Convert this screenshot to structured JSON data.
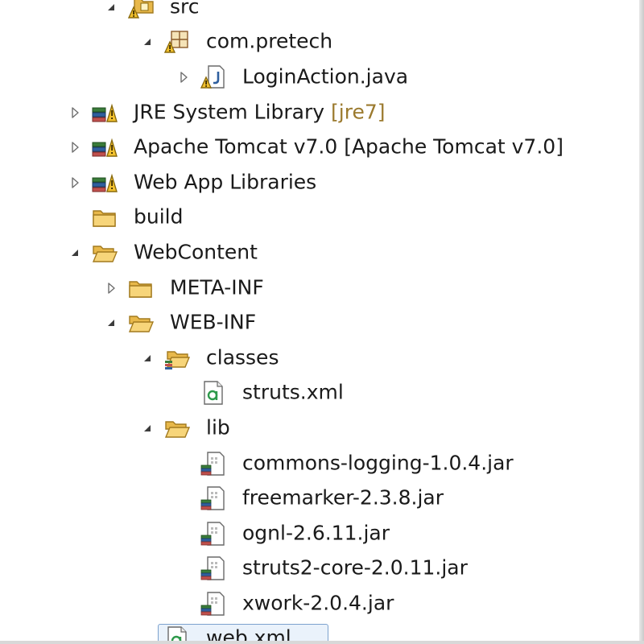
{
  "tree": [
    {
      "label": "src",
      "icon": "source-folder-warning-icon",
      "depth": 0,
      "toggle": "expanded"
    },
    {
      "label": "com.pretech",
      "icon": "package-warning-icon",
      "depth": 1,
      "toggle": "expanded"
    },
    {
      "label": "LoginAction.java",
      "icon": "java-file-warning-icon",
      "depth": 2,
      "toggle": "collapsed"
    },
    {
      "label": "JRE System Library",
      "decoration": "[jre7]",
      "icon": "library-icon",
      "depth": -1,
      "toggle": "collapsed"
    },
    {
      "label": "Apache Tomcat v7.0 [Apache Tomcat v7.0]",
      "icon": "library-icon",
      "depth": -1,
      "toggle": "collapsed"
    },
    {
      "label": "Web App Libraries",
      "icon": "library-icon",
      "depth": -1,
      "toggle": "collapsed"
    },
    {
      "label": "build",
      "icon": "folder-icon",
      "depth": -1,
      "toggle": "none"
    },
    {
      "label": "WebContent",
      "icon": "folder-open-icon",
      "depth": -1,
      "toggle": "expanded"
    },
    {
      "label": "META-INF",
      "icon": "folder-icon",
      "depth": 0,
      "toggle": "collapsed"
    },
    {
      "label": "WEB-INF",
      "icon": "folder-open-icon",
      "depth": 0,
      "toggle": "expanded"
    },
    {
      "label": "classes",
      "icon": "folder-open-stack-icon",
      "depth": 1,
      "toggle": "expanded"
    },
    {
      "label": "struts.xml",
      "icon": "xml-file-icon",
      "depth": 2,
      "toggle": "none"
    },
    {
      "label": "lib",
      "icon": "folder-open-icon",
      "depth": 1,
      "toggle": "expanded"
    },
    {
      "label": "commons-logging-1.0.4.jar",
      "icon": "jar-file-icon",
      "depth": 2,
      "toggle": "none"
    },
    {
      "label": "freemarker-2.3.8.jar",
      "icon": "jar-file-icon",
      "depth": 2,
      "toggle": "none"
    },
    {
      "label": "ognl-2.6.11.jar",
      "icon": "jar-file-icon",
      "depth": 2,
      "toggle": "none"
    },
    {
      "label": "struts2-core-2.0.11.jar",
      "icon": "jar-file-icon",
      "depth": 2,
      "toggle": "none"
    },
    {
      "label": "xwork-2.0.4.jar",
      "icon": "jar-file-icon",
      "depth": 2,
      "toggle": "none"
    },
    {
      "label": "web.xml",
      "icon": "xml-file-icon",
      "depth": 1,
      "toggle": "none",
      "selected": true
    }
  ],
  "colors": {
    "text": "#1a1a1a",
    "decoration": "#9b7a2e",
    "selection_fill": "#eaf2fb",
    "selection_border": "#7da2ce",
    "folder": "#e8b84a"
  }
}
